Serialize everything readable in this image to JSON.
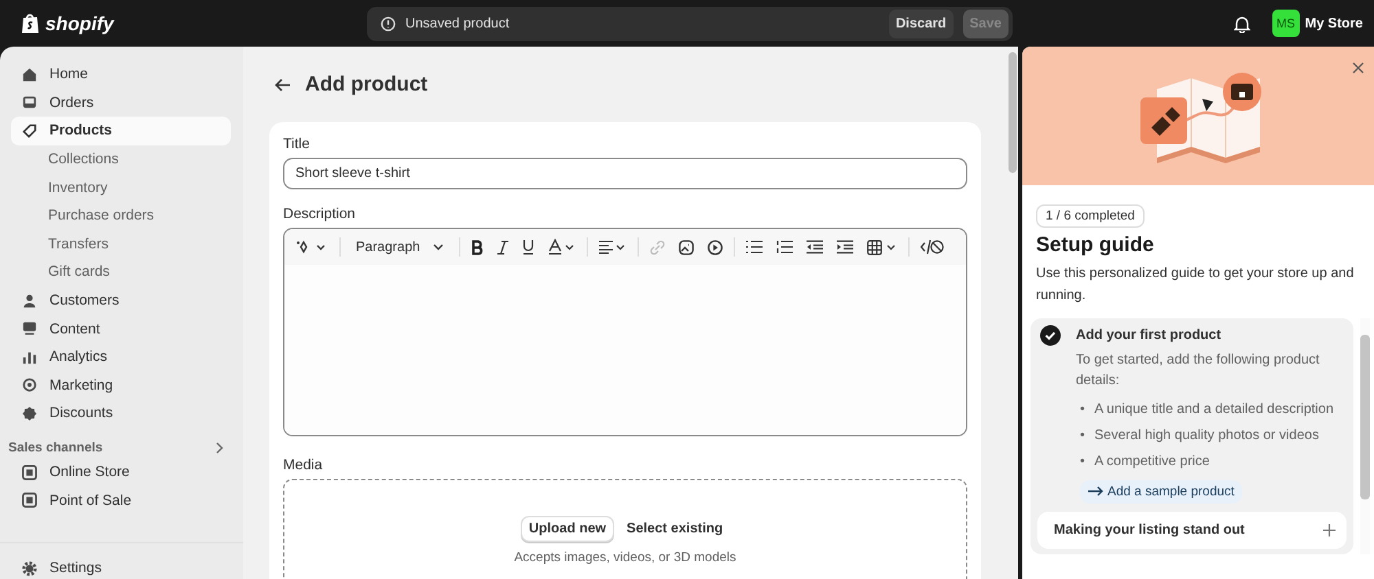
{
  "top_bar": {
    "logo": "shopify",
    "context_bar": {
      "message": "Unsaved product",
      "buttons": [
        {
          "label": "Discard",
          "disabled": false
        },
        {
          "label": "Save",
          "disabled": true
        }
      ]
    },
    "account": {
      "initials": "MS",
      "color": "#36e03a",
      "store": "My Store"
    }
  },
  "sidebar": {
    "items": [
      {
        "label": "Home",
        "selected": false
      },
      {
        "label": "Orders",
        "selected": false
      },
      {
        "label": "Products",
        "selected": true,
        "children": [
          {
            "label": "Collections",
            "selected": false
          },
          {
            "label": "Inventory",
            "selected": false
          },
          {
            "label": "Purchase orders",
            "selected": false
          },
          {
            "label": "Transfers",
            "selected": false
          },
          {
            "label": "Gift cards",
            "selected": false
          }
        ]
      },
      {
        "label": "Customers",
        "selected": false
      },
      {
        "label": "Content",
        "selected": false
      },
      {
        "label": "Analytics",
        "selected": false
      },
      {
        "label": "Marketing",
        "selected": false
      },
      {
        "label": "Discounts",
        "selected": false
      }
    ],
    "sales_channels": {
      "heading": "Sales channels",
      "items": [
        {
          "label": "Online Store",
          "selected": false
        },
        {
          "label": "Point of Sale",
          "selected": false
        }
      ]
    },
    "settings": {
      "label": "Settings",
      "selected": false
    }
  },
  "page": {
    "title": "Add product",
    "title_field": {
      "label": "Title",
      "value": "Short sleeve t-shirt"
    },
    "description": {
      "label": "Description",
      "format": "Paragraph"
    },
    "media": {
      "label": "Media",
      "upload": "Upload new",
      "select": "Select existing",
      "hint": "Accepts images, videos, or 3D models"
    }
  },
  "setup_guide": {
    "progress": "1 / 6 completed",
    "title": "Setup guide",
    "intro": "Use this personalized guide to get your store up and running.",
    "tasks": [
      {
        "title": "Add your first product",
        "completed": true,
        "expanded": true,
        "text": "To get started, add the following product details:",
        "bullets": [
          {
            "marker": "•",
            "text": "A unique title and a detailed description"
          },
          {
            "marker": "•",
            "text": "Several high quality photos or videos"
          },
          {
            "marker": "•",
            "text": "A competitive price"
          }
        ],
        "action": "Add a sample product"
      },
      {
        "title": "Making your listing stand out",
        "expanded": false
      }
    ]
  }
}
